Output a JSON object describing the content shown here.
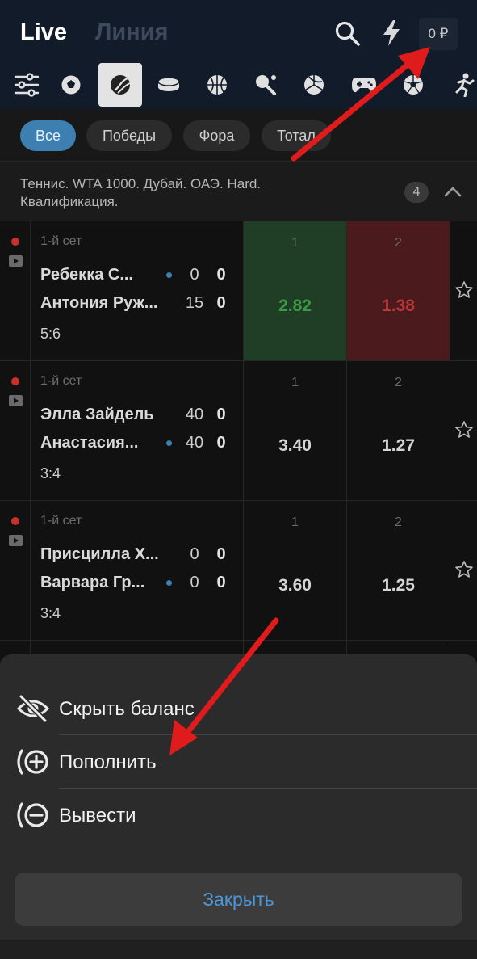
{
  "header": {
    "tab_live": "Live",
    "tab_line": "Линия",
    "balance": "0 ₽",
    "icons": [
      "search-icon",
      "flash-icon"
    ]
  },
  "sports": [
    "filter-icon",
    "football-icon",
    "tennis-icon",
    "hockey-icon",
    "basketball-icon",
    "table-tennis-icon",
    "volleyball-icon",
    "esports-icon",
    "futsal-icon",
    "athletics-icon"
  ],
  "filters": [
    "Все",
    "Победы",
    "Фора",
    "Тотал"
  ],
  "tournament": {
    "title": "Теннис. WTA 1000. Дубай. ОАЭ. Hard. Квалификация.",
    "count": "4"
  },
  "matches": [
    {
      "set": "1-й сет",
      "p1": "Ребекка С...",
      "p1_points": "0",
      "p1_games": "0",
      "p2": "Антония Руж...",
      "p2_points": "15",
      "p2_games": "0",
      "score": "5:6",
      "odds_label_1": "1",
      "odds_1": "2.82",
      "odds_label_2": "2",
      "odds_2": "1.38"
    },
    {
      "set": "1-й сет",
      "p1": "Элла Зайдель",
      "p1_points": "40",
      "p1_games": "0",
      "p2": "Анастасия...",
      "p2_points": "40",
      "p2_games": "0",
      "score": "3:4",
      "odds_label_1": "1",
      "odds_1": "3.40",
      "odds_label_2": "2",
      "odds_2": "1.27"
    },
    {
      "set": "1-й сет",
      "p1": "Присцилла Х...",
      "p1_points": "0",
      "p1_games": "0",
      "p2": "Варвара Гр...",
      "p2_points": "0",
      "p2_games": "0",
      "score": "3:4",
      "odds_label_1": "1",
      "odds_1": "3.60",
      "odds_label_2": "2",
      "odds_2": "1.25"
    }
  ],
  "sheet": {
    "hide_balance": "Скрыть баланс",
    "deposit": "Пополнить",
    "withdraw": "Вывести",
    "close": "Закрыть"
  },
  "colors": {
    "header_bg": "#121b2a",
    "accent": "#3d7fb1",
    "odds_up": "#3c9a46",
    "odds_down": "#b7373a",
    "arrow": "#e01b1b"
  }
}
